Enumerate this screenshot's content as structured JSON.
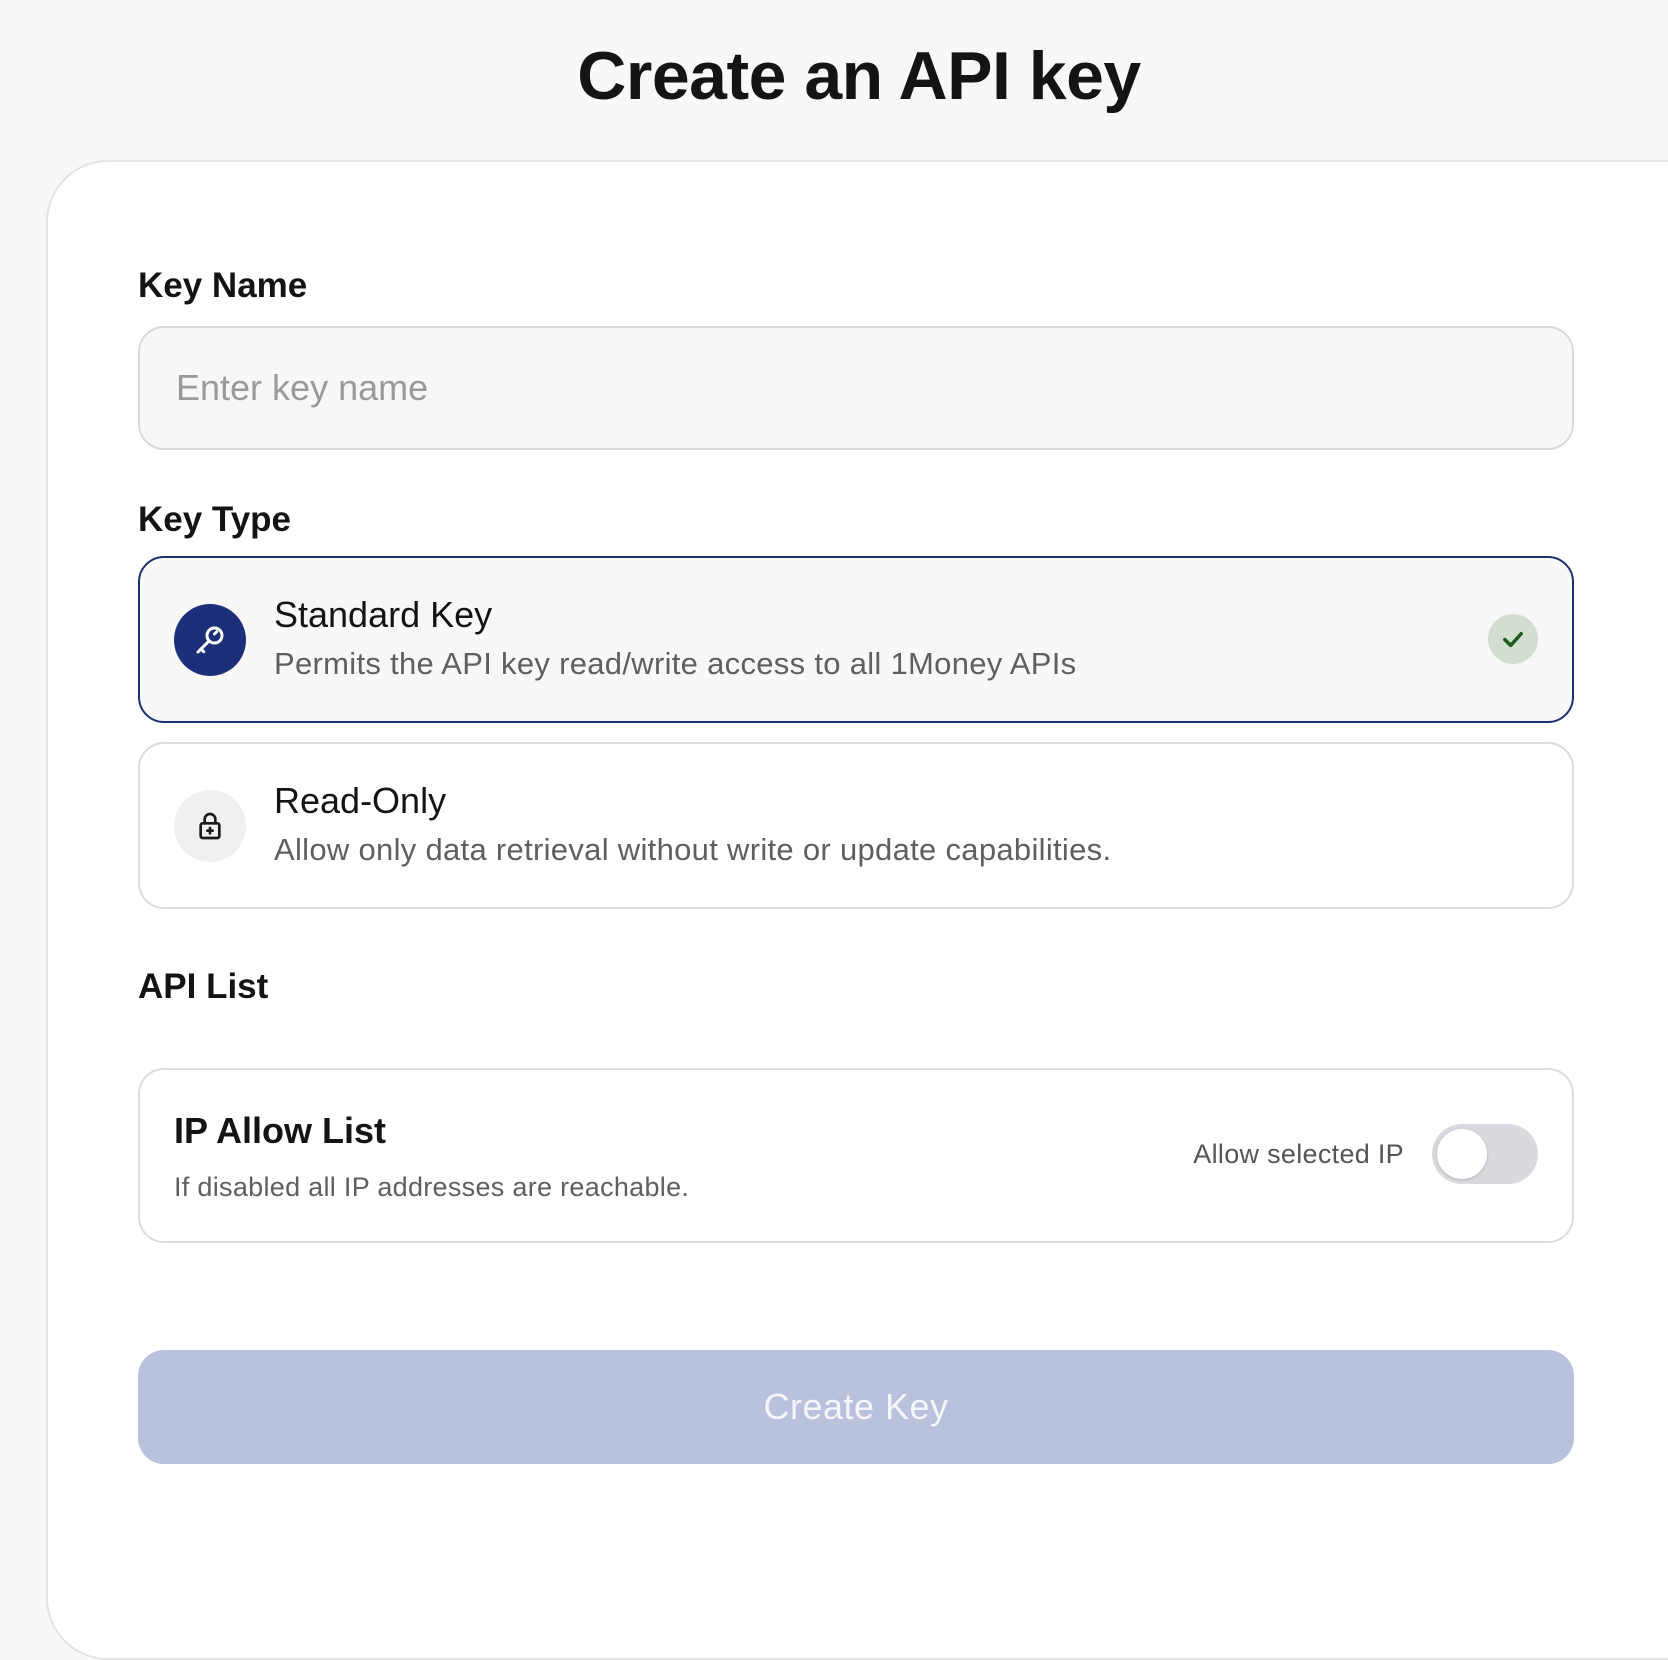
{
  "page": {
    "title": "Create an API key"
  },
  "form": {
    "key_name_label": "Key Name",
    "key_name_placeholder": "Enter key name",
    "key_name_value": "",
    "key_type_label": "Key Type",
    "key_types": [
      {
        "title": "Standard Key",
        "description": "Permits the API key read/write access to all 1Money APIs",
        "icon": "key-icon",
        "selected": true
      },
      {
        "title": "Read-Only",
        "description": "Allow only data retrieval without write or update capabilities.",
        "icon": "lock-icon",
        "selected": false
      }
    ],
    "api_list_label": "API List",
    "ip_allow_list": {
      "title": "IP Allow List",
      "description": "If disabled all IP addresses are reachable.",
      "toggle_label": "Allow selected IP",
      "enabled": false
    },
    "submit_label": "Create Key",
    "submit_disabled": true
  },
  "colors": {
    "accent": "#1c307a",
    "selected_border": "#1d3170",
    "check_badge_bg": "#d3ddd0",
    "check_color": "#1e5a1e",
    "button_disabled_bg": "#b9c1dc",
    "toggle_off_bg": "#d8dae0"
  }
}
